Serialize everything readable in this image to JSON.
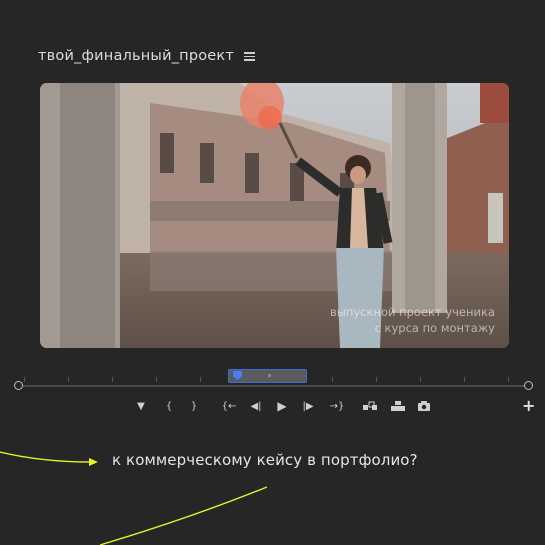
{
  "project": {
    "title": "твой_финальный_проект",
    "menu_icon": "hamburger-icon"
  },
  "preview": {
    "caption_line1": "выпускной проект ученика",
    "caption_line2": "с курса по монтажу"
  },
  "timeline": {
    "playhead_position": 0.47,
    "icons": {
      "start": "circle-handle",
      "end": "circle-handle"
    }
  },
  "controls": {
    "marker": "▼",
    "in_bracket": "{",
    "out_bracket": "}",
    "go_to_in": "{←",
    "step_back": "◀|",
    "play": "▶",
    "step_forward": "|▶",
    "go_to_out": "→}",
    "insert": "insert-icon",
    "overwrite": "overwrite-icon",
    "camera": "camera-icon",
    "add": "+"
  },
  "question": {
    "text": "к коммерческому кейсу в портфолио?"
  },
  "colors": {
    "background": "#262626",
    "accent_line": "#e3f22a",
    "playhead": "#4a7cf5"
  }
}
